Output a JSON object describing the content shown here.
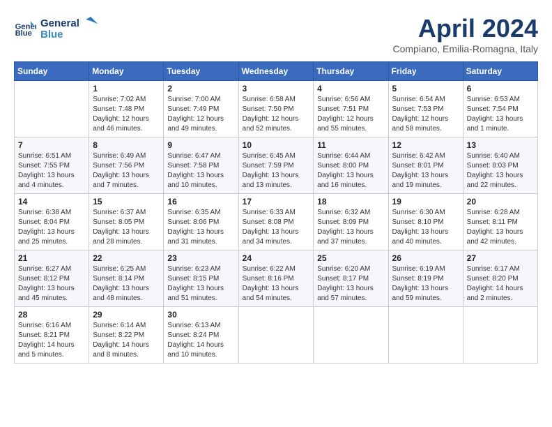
{
  "header": {
    "logo_line1": "General",
    "logo_line2": "Blue",
    "month_title": "April 2024",
    "subtitle": "Compiano, Emilia-Romagna, Italy"
  },
  "weekdays": [
    "Sunday",
    "Monday",
    "Tuesday",
    "Wednesday",
    "Thursday",
    "Friday",
    "Saturday"
  ],
  "weeks": [
    [
      {
        "day": "",
        "info": ""
      },
      {
        "day": "1",
        "info": "Sunrise: 7:02 AM\nSunset: 7:48 PM\nDaylight: 12 hours\nand 46 minutes."
      },
      {
        "day": "2",
        "info": "Sunrise: 7:00 AM\nSunset: 7:49 PM\nDaylight: 12 hours\nand 49 minutes."
      },
      {
        "day": "3",
        "info": "Sunrise: 6:58 AM\nSunset: 7:50 PM\nDaylight: 12 hours\nand 52 minutes."
      },
      {
        "day": "4",
        "info": "Sunrise: 6:56 AM\nSunset: 7:51 PM\nDaylight: 12 hours\nand 55 minutes."
      },
      {
        "day": "5",
        "info": "Sunrise: 6:54 AM\nSunset: 7:53 PM\nDaylight: 12 hours\nand 58 minutes."
      },
      {
        "day": "6",
        "info": "Sunrise: 6:53 AM\nSunset: 7:54 PM\nDaylight: 13 hours\nand 1 minute."
      }
    ],
    [
      {
        "day": "7",
        "info": "Sunrise: 6:51 AM\nSunset: 7:55 PM\nDaylight: 13 hours\nand 4 minutes."
      },
      {
        "day": "8",
        "info": "Sunrise: 6:49 AM\nSunset: 7:56 PM\nDaylight: 13 hours\nand 7 minutes."
      },
      {
        "day": "9",
        "info": "Sunrise: 6:47 AM\nSunset: 7:58 PM\nDaylight: 13 hours\nand 10 minutes."
      },
      {
        "day": "10",
        "info": "Sunrise: 6:45 AM\nSunset: 7:59 PM\nDaylight: 13 hours\nand 13 minutes."
      },
      {
        "day": "11",
        "info": "Sunrise: 6:44 AM\nSunset: 8:00 PM\nDaylight: 13 hours\nand 16 minutes."
      },
      {
        "day": "12",
        "info": "Sunrise: 6:42 AM\nSunset: 8:01 PM\nDaylight: 13 hours\nand 19 minutes."
      },
      {
        "day": "13",
        "info": "Sunrise: 6:40 AM\nSunset: 8:03 PM\nDaylight: 13 hours\nand 22 minutes."
      }
    ],
    [
      {
        "day": "14",
        "info": "Sunrise: 6:38 AM\nSunset: 8:04 PM\nDaylight: 13 hours\nand 25 minutes."
      },
      {
        "day": "15",
        "info": "Sunrise: 6:37 AM\nSunset: 8:05 PM\nDaylight: 13 hours\nand 28 minutes."
      },
      {
        "day": "16",
        "info": "Sunrise: 6:35 AM\nSunset: 8:06 PM\nDaylight: 13 hours\nand 31 minutes."
      },
      {
        "day": "17",
        "info": "Sunrise: 6:33 AM\nSunset: 8:08 PM\nDaylight: 13 hours\nand 34 minutes."
      },
      {
        "day": "18",
        "info": "Sunrise: 6:32 AM\nSunset: 8:09 PM\nDaylight: 13 hours\nand 37 minutes."
      },
      {
        "day": "19",
        "info": "Sunrise: 6:30 AM\nSunset: 8:10 PM\nDaylight: 13 hours\nand 40 minutes."
      },
      {
        "day": "20",
        "info": "Sunrise: 6:28 AM\nSunset: 8:11 PM\nDaylight: 13 hours\nand 42 minutes."
      }
    ],
    [
      {
        "day": "21",
        "info": "Sunrise: 6:27 AM\nSunset: 8:12 PM\nDaylight: 13 hours\nand 45 minutes."
      },
      {
        "day": "22",
        "info": "Sunrise: 6:25 AM\nSunset: 8:14 PM\nDaylight: 13 hours\nand 48 minutes."
      },
      {
        "day": "23",
        "info": "Sunrise: 6:23 AM\nSunset: 8:15 PM\nDaylight: 13 hours\nand 51 minutes."
      },
      {
        "day": "24",
        "info": "Sunrise: 6:22 AM\nSunset: 8:16 PM\nDaylight: 13 hours\nand 54 minutes."
      },
      {
        "day": "25",
        "info": "Sunrise: 6:20 AM\nSunset: 8:17 PM\nDaylight: 13 hours\nand 57 minutes."
      },
      {
        "day": "26",
        "info": "Sunrise: 6:19 AM\nSunset: 8:19 PM\nDaylight: 13 hours\nand 59 minutes."
      },
      {
        "day": "27",
        "info": "Sunrise: 6:17 AM\nSunset: 8:20 PM\nDaylight: 14 hours\nand 2 minutes."
      }
    ],
    [
      {
        "day": "28",
        "info": "Sunrise: 6:16 AM\nSunset: 8:21 PM\nDaylight: 14 hours\nand 5 minutes."
      },
      {
        "day": "29",
        "info": "Sunrise: 6:14 AM\nSunset: 8:22 PM\nDaylight: 14 hours\nand 8 minutes."
      },
      {
        "day": "30",
        "info": "Sunrise: 6:13 AM\nSunset: 8:24 PM\nDaylight: 14 hours\nand 10 minutes."
      },
      {
        "day": "",
        "info": ""
      },
      {
        "day": "",
        "info": ""
      },
      {
        "day": "",
        "info": ""
      },
      {
        "day": "",
        "info": ""
      }
    ]
  ]
}
